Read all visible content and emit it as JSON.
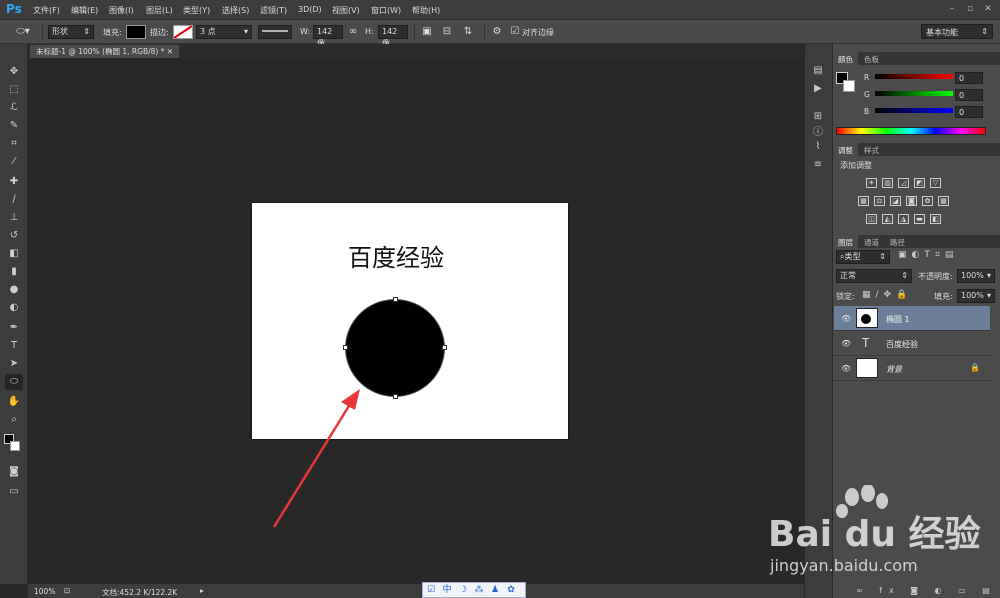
{
  "app": {
    "logo": "Ps"
  },
  "menu": [
    "文件(F)",
    "编辑(E)",
    "图像(I)",
    "图层(L)",
    "类型(Y)",
    "选择(S)",
    "滤镜(T)",
    "3D(D)",
    "视图(V)",
    "窗口(W)",
    "帮助(H)"
  ],
  "options": {
    "mode": "形状",
    "fill_label": "填充:",
    "stroke_label": "描边:",
    "stroke_width": "3 点",
    "w_label": "W:",
    "w_value": "142 像",
    "h_label": "H:",
    "h_value": "142 像",
    "align_edges": "对齐边缘",
    "workspace": "基本功能"
  },
  "document": {
    "tab": "未标题-1 @ 100% (椭圆 1, RGB/8) *",
    "canvas_text": "百度经验"
  },
  "status": {
    "zoom": "100%",
    "doc_size": "文档:452.2 K/122.2K"
  },
  "image_toolbar": [
    "☑",
    "中",
    "☽",
    "⁂",
    "♟",
    "✿"
  ],
  "color_panel": {
    "tabs": [
      "颜色",
      "色板"
    ],
    "r_label": "R",
    "g_label": "G",
    "b_label": "B",
    "r": "0",
    "g": "0",
    "b": "0"
  },
  "adjust_panel": {
    "tabs": [
      "调整",
      "样式"
    ],
    "title": "添加调整"
  },
  "layers_panel": {
    "tabs": [
      "图层",
      "通道",
      "路径"
    ],
    "filter": "类型",
    "blend_mode": "正常",
    "opacity_label": "不透明度:",
    "opacity": "100%",
    "lock_label": "锁定:",
    "fill_label": "填充:",
    "fill": "100%",
    "layers": [
      {
        "name": "椭圆 1",
        "selected": true
      },
      {
        "name": "百度经验",
        "selected": false
      },
      {
        "name": "背景",
        "selected": false
      }
    ]
  },
  "watermark": {
    "brand": "Bai du 经验",
    "url": "jingyan.baidu.com"
  },
  "colors": {
    "accent": "#31a8ff",
    "arrow": "#e8353a",
    "layer_selected": "#6d7f98"
  }
}
